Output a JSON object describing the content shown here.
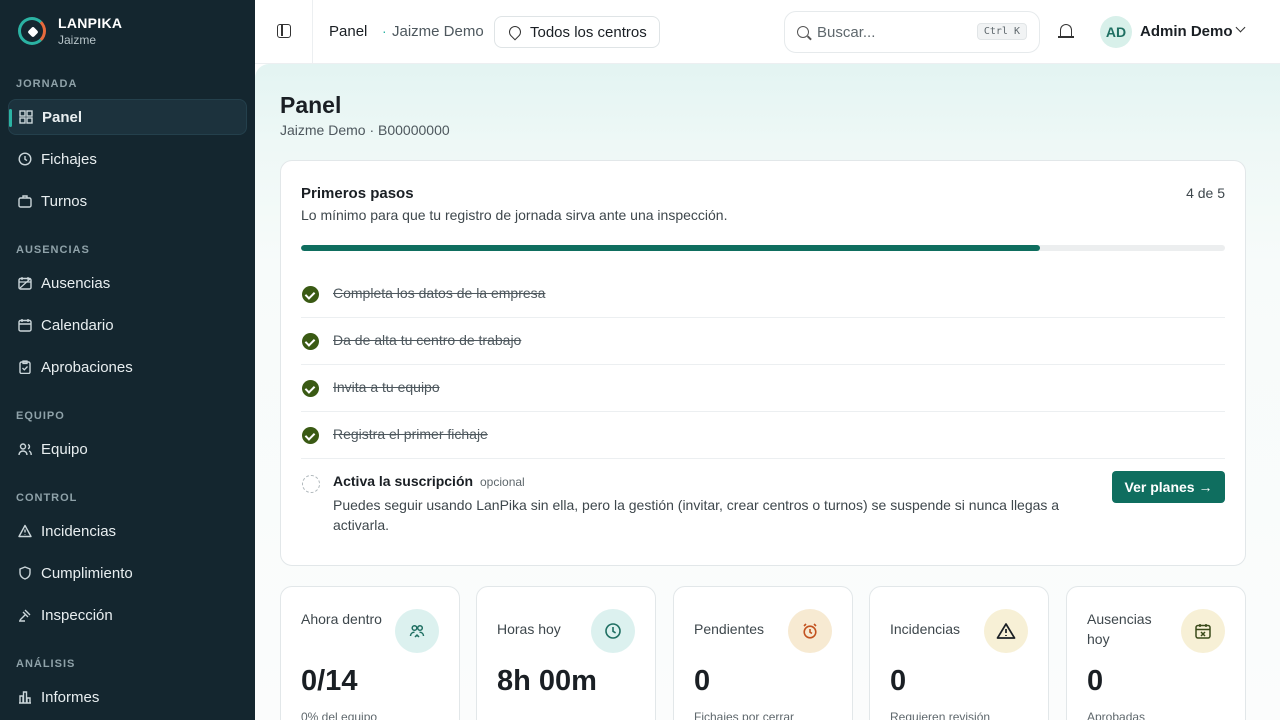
{
  "brand": {
    "name": "LANPIKA",
    "sub": "Jaizme"
  },
  "sidebar": {
    "sections": [
      {
        "title": "JORNADA"
      },
      {
        "title": "AUSENCIAS"
      },
      {
        "title": "EQUIPO"
      },
      {
        "title": "CONTROL"
      },
      {
        "title": "ANÁLISIS"
      }
    ],
    "items": [
      {
        "label": "Panel",
        "icon": "grid-icon",
        "active": true
      },
      {
        "label": "Fichajes",
        "icon": "clock-icon"
      },
      {
        "label": "Turnos",
        "icon": "briefcase-icon"
      },
      {
        "label": "Ausencias",
        "icon": "calendar-off-icon"
      },
      {
        "label": "Calendario",
        "icon": "calendar-icon"
      },
      {
        "label": "Aprobaciones",
        "icon": "clipboard-check-icon"
      },
      {
        "label": "Equipo",
        "icon": "users-icon"
      },
      {
        "label": "Incidencias",
        "icon": "alert-triangle-icon"
      },
      {
        "label": "Cumplimiento",
        "icon": "shield-icon"
      },
      {
        "label": "Inspección",
        "icon": "scale-icon"
      },
      {
        "label": "Informes",
        "icon": "bar-chart-icon"
      }
    ]
  },
  "topbar": {
    "crumb_current": "Panel",
    "crumb_company": "Jaizme Demo",
    "centers_label": "Todos los centros",
    "search_placeholder": "Buscar...",
    "search_shortcut": "Ctrl K",
    "user_initials": "AD",
    "user_name": "Admin Demo"
  },
  "page": {
    "title": "Panel",
    "subtitle": "Jaizme Demo · B00000000"
  },
  "onboarding": {
    "title": "Primeros pasos",
    "description": "Lo mínimo para que tu registro de jornada sirva ante una inspección.",
    "count": "4 de 5",
    "progress": 0.8,
    "steps": [
      {
        "label": "Completa los datos de la empresa",
        "done": true
      },
      {
        "label": "Da de alta tu centro de trabajo",
        "done": true
      },
      {
        "label": "Invita a tu equipo",
        "done": true
      },
      {
        "label": "Registra el primer fichaje",
        "done": true
      }
    ],
    "pending": {
      "title": "Activa la suscripción",
      "tag": "opcional",
      "description": "Puedes seguir usando LanPika sin ella, pero la gestión (invitar, crear centros o turnos) se suspende si nunca llegas a activarla.",
      "button": "Ver planes →"
    }
  },
  "stats": [
    {
      "label": "Ahora dentro",
      "value": "0/14",
      "sub": "0% del equipo",
      "icon": "users-presence-icon",
      "tone": "teal"
    },
    {
      "label": "Horas hoy",
      "value": "8h 00m",
      "sub": "",
      "icon": "clock-icon",
      "tone": "teal"
    },
    {
      "label": "Pendientes",
      "value": "0",
      "sub": "Fichajes por cerrar",
      "icon": "alarm-clock-icon",
      "tone": "amber"
    },
    {
      "label": "Incidencias",
      "value": "0",
      "sub": "Requieren revisión",
      "icon": "alert-triangle-icon",
      "tone": "yellow"
    },
    {
      "label": "Ausencias hoy",
      "value": "0",
      "sub": "Aprobadas",
      "icon": "calendar-off-icon",
      "tone": "yellow"
    }
  ],
  "colors": {
    "sidebar": "#14262f",
    "accent": "#0f6e5f",
    "check": "#3a5a14",
    "brand_teal": "#2bb3a3"
  }
}
